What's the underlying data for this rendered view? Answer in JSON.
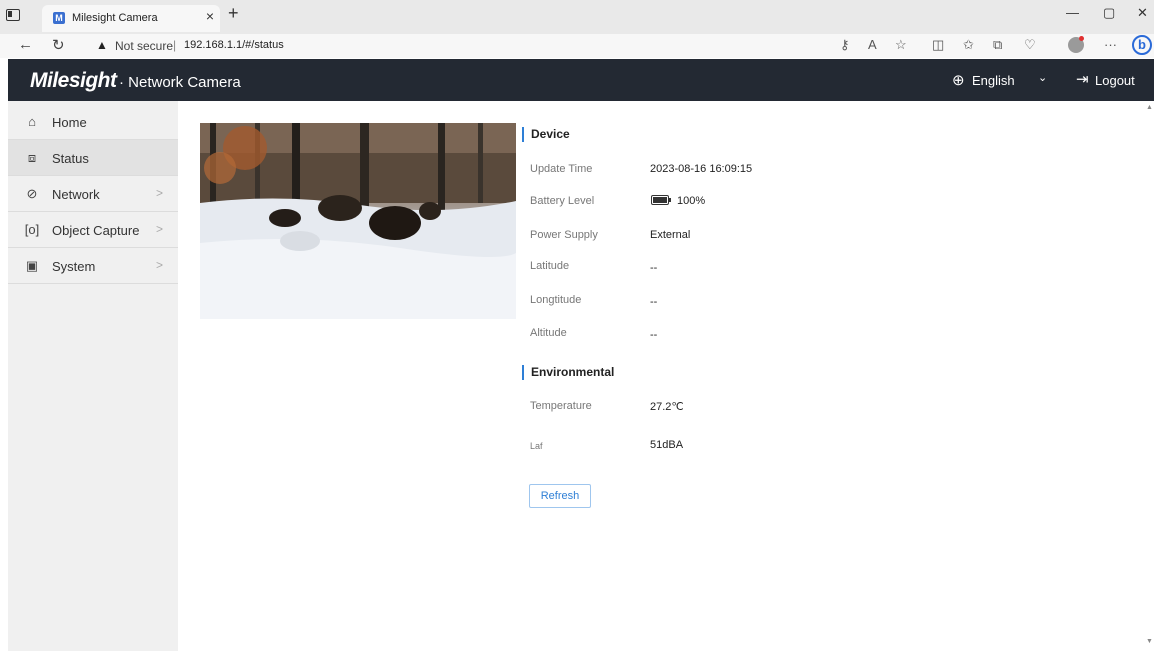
{
  "browser": {
    "tab_title": "Milesight Camera",
    "tab_favicon": "M",
    "tab_close": "×",
    "new_tab": "+",
    "security_label": "Not secure",
    "url": "192.168.1.1/#/status",
    "bing_label": "b"
  },
  "header": {
    "logo": "Milesight",
    "logo_sub": "· Network Camera",
    "language": "English",
    "logout": "Logout"
  },
  "sidebar": {
    "items": [
      {
        "label": "Home",
        "icon": "home-icon",
        "active": false,
        "has_children": false
      },
      {
        "label": "Status",
        "icon": "status-icon",
        "active": true,
        "has_children": false
      },
      {
        "label": "Network",
        "icon": "network-icon",
        "active": false,
        "has_children": true
      },
      {
        "label": "Object Capture",
        "icon": "object-capture-icon",
        "active": false,
        "has_children": true
      },
      {
        "label": "System",
        "icon": "system-icon",
        "active": false,
        "has_children": true
      }
    ]
  },
  "device": {
    "title": "Device",
    "rows": [
      {
        "label": "Update Time",
        "value": "2023-08-16 16:09:15"
      },
      {
        "label": "Battery Level",
        "value": "100%"
      },
      {
        "label": "Power Supply",
        "value": "External"
      },
      {
        "label": "Latitude",
        "value": "--"
      },
      {
        "label": "Longtitude",
        "value": "--"
      },
      {
        "label": "Altitude",
        "value": "--"
      }
    ],
    "battery_level": 1.0
  },
  "environmental": {
    "title": "Environmental",
    "rows": [
      {
        "label": "Temperature",
        "value": "27.2℃"
      },
      {
        "label": "Laf",
        "value": "51dBA"
      }
    ]
  },
  "actions": {
    "refresh": "Refresh"
  },
  "colors": {
    "header_bg": "#232933",
    "sidebar_bg": "#f0f0f0",
    "accent": "#2e7fd6"
  }
}
